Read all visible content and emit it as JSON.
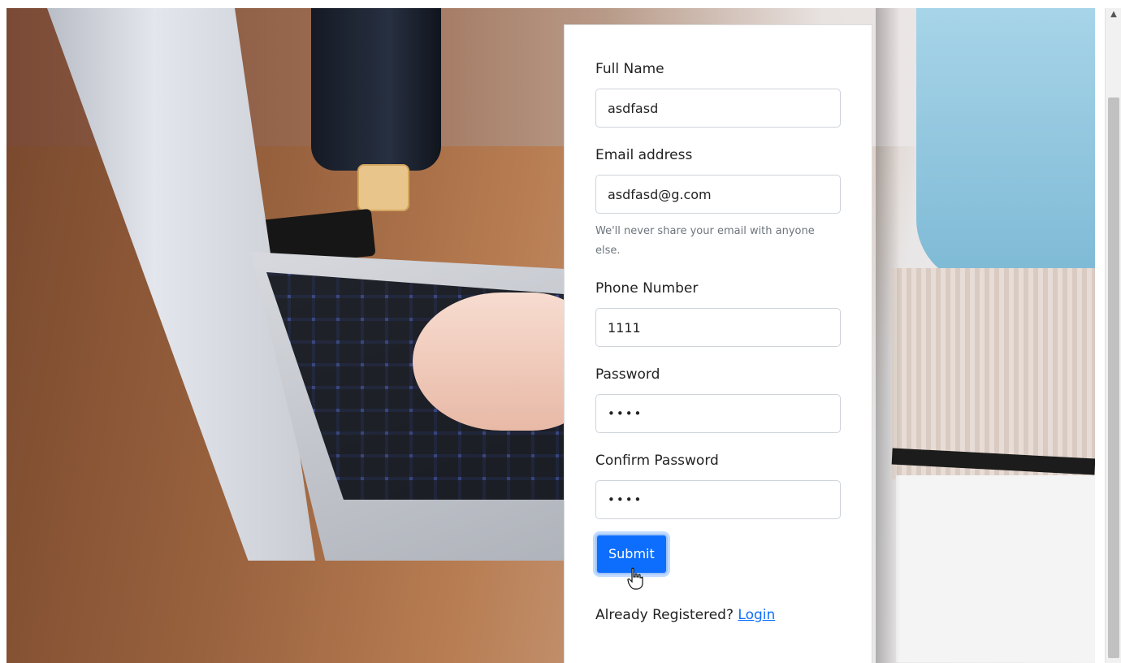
{
  "form": {
    "fields": [
      {
        "label": "Full Name",
        "value": "asdfasd"
      },
      {
        "label": "Email address",
        "value": "asdfasd@g.com",
        "help": "We'll never share your email with anyone else."
      },
      {
        "label": "Phone Number",
        "value": "1111"
      },
      {
        "label": "Password",
        "value": "••••"
      },
      {
        "label": "Confirm Password",
        "value": "••••"
      }
    ],
    "submit_label": "Submit",
    "footer_text": "Already Registered?",
    "login_link": "Login"
  },
  "colors": {
    "primary": "#0d6efd",
    "help_text": "#6c757d"
  },
  "icons": {
    "cursor": "hand-pointer-icon",
    "scroll_up": "chevron-up-icon"
  }
}
